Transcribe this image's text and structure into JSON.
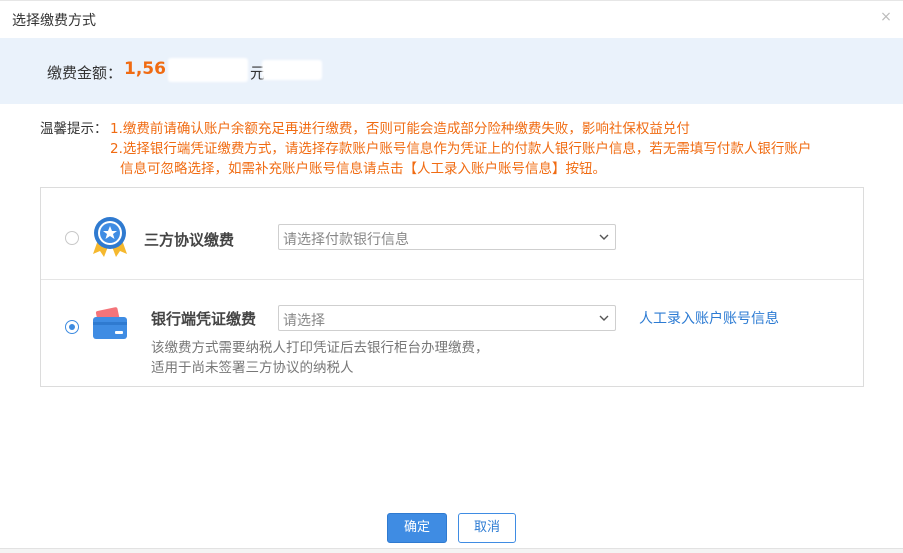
{
  "dialog": {
    "title": "选择缴费方式",
    "close_symbol": "×"
  },
  "amount": {
    "label": "缴费金额：",
    "value": "1,56",
    "unit": "元"
  },
  "notice": {
    "label": "温馨提示：",
    "line1": "1.缴费前请确认账户余额充足再进行缴费，否则可能会造成部分险种缴费失败，影响社保权益兑付",
    "line2": "2.选择银行端凭证缴费方式，请选择存款账户账号信息作为凭证上的付款人银行账户信息，若无需填写付款人银行账户",
    "line3": "信息可忽略选择，如需补充账户账号信息请点击【人工录入账户账号信息】按钮。"
  },
  "options": [
    {
      "title": "三方协议缴费",
      "selected": false,
      "select_placeholder": "请选择付款银行信息"
    },
    {
      "title": "银行端凭证缴费",
      "selected": true,
      "select_placeholder": "请选择",
      "link": "人工录入账户账号信息",
      "desc_line1": "该缴费方式需要纳税人打印凭证后去银行柜台办理缴费，",
      "desc_line2": "适用于尚未签署三方协议的纳税人"
    }
  ],
  "buttons": {
    "ok": "确定",
    "cancel": "取消"
  },
  "colors": {
    "accent": "#3f8ce3",
    "warning": "#f06b12",
    "band": "#eaf2fb"
  }
}
